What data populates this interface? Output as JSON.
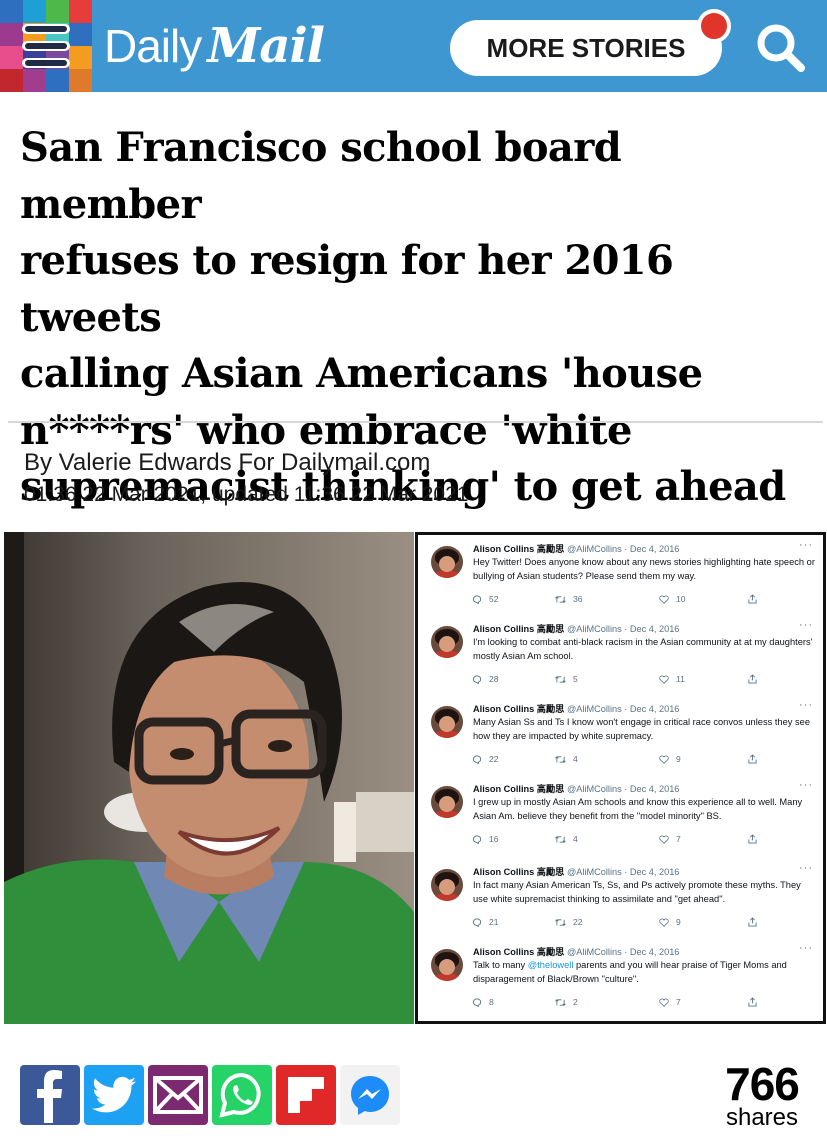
{
  "header": {
    "logo_daily": "Daily",
    "logo_mail": "Mail",
    "more_stories_label": "MORE STORIES",
    "brand_color": "#3e97d1",
    "notification_color": "#e0352b",
    "mosaic_colors": [
      "#2f6fbf",
      "#1e9fd5",
      "#4fb84a",
      "#e83c3a",
      "#9b3a8e",
      "#f39c1f",
      "#48c6c2",
      "#2f6fbf",
      "#e94e8c",
      "#3a3f9b",
      "#7a4a9b",
      "#f39c1f",
      "#c2272d",
      "#a23c8f",
      "#2f6fbf",
      "#e07a2b"
    ]
  },
  "article": {
    "headline_lines": [
      "San Francisco school board member",
      "refuses to resign for her 2016 tweets",
      "calling Asian Americans 'house",
      "n****rs' who embrace 'white",
      "supremacist thinking' to get ahead"
    ],
    "byline": "By Valerie Edwards For Dailymail.com",
    "dateline": "01:36 22 Mar 2021, updated 11:36 22 Mar 2021"
  },
  "tweets": [
    {
      "name": "Alison Collins 高勵思",
      "meta": "@AliMCollins · Dec 4, 2016",
      "text": "Hey Twitter! Does anyone know about any news stories highlighting hate speech or bullying of Asian students? Please send them my way.",
      "replies": "52",
      "retweets": "36",
      "likes": "10"
    },
    {
      "name": "Alison Collins 高勵思",
      "meta": "@AliMCollins · Dec 4, 2016",
      "text": "I'm looking to combat anti-black racism in the Asian community at at my daughters' mostly Asian Am school.",
      "replies": "28",
      "retweets": "5",
      "likes": "11"
    },
    {
      "name": "Alison Collins 高勵思",
      "meta": "@AliMCollins · Dec 4, 2016",
      "text": "Many Asian Ss and Ts I know won't engage in critical race convos unless they see how they are impacted by white supremacy.",
      "replies": "22",
      "retweets": "4",
      "likes": "9"
    },
    {
      "name": "Alison Collins 高勵思",
      "meta": "@AliMCollins · Dec 4, 2016",
      "text": "I grew up in mostly Asian Am schools and know this experience all to well. Many Asian Am. believe they benefit from the \"model minority\" BS.",
      "replies": "16",
      "retweets": "4",
      "likes": "7"
    },
    {
      "name": "Alison Collins 高勵思",
      "meta": "@AliMCollins · Dec 4, 2016",
      "text": "In fact many Asian American Ts, Ss, and Ps actively promote these myths. They use white supremacist thinking to assimilate and \"get ahead\".",
      "replies": "21",
      "retweets": "22",
      "likes": "9"
    },
    {
      "name": "Alison Collins 高勵思",
      "meta": "@AliMCollins · Dec 4, 2016",
      "text_before": "Talk to many ",
      "mention": "@thelowell",
      "text_after": " parents and you will hear praise of Tiger Moms and disparagement of Black/Brown \"culture\".",
      "replies": "8",
      "retweets": "2",
      "likes": "7"
    }
  ],
  "share_bar": {
    "count": "766",
    "label": "shares",
    "buttons": [
      {
        "icon": "facebook-icon",
        "color": "#3b5998"
      },
      {
        "icon": "twitter-icon",
        "color": "#1da1f2"
      },
      {
        "icon": "email-icon",
        "color": "#7b2a6f"
      },
      {
        "icon": "whatsapp-icon",
        "color": "#25d366"
      },
      {
        "icon": "flipboard-icon",
        "color": "#e12828"
      },
      {
        "icon": "messenger-icon",
        "color": "#f2f2f2"
      }
    ]
  }
}
